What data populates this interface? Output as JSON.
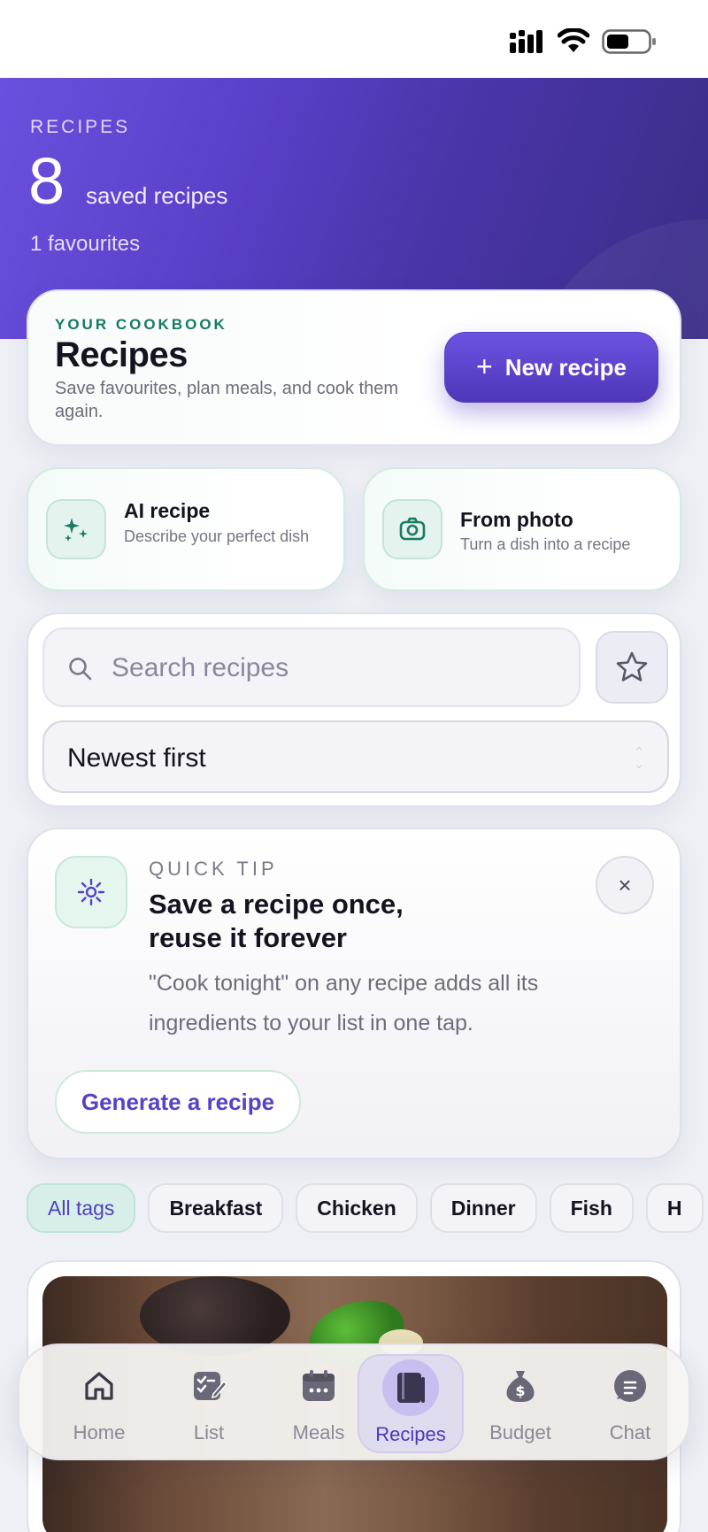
{
  "hero": {
    "label": "RECIPES",
    "count": "8",
    "count_label": "saved recipes",
    "favourites": "1 favourites"
  },
  "cookbook": {
    "eyebrow": "YOUR COOKBOOK",
    "title": "Recipes",
    "description": "Save favourites, plan meals, and cook them again.",
    "new_button": "New recipe"
  },
  "actions": {
    "ai": {
      "title": "AI recipe",
      "subtitle": "Describe your perfect dish",
      "icon": "sparkles-icon"
    },
    "photo": {
      "title": "From photo",
      "subtitle": "Turn a dish into a recipe",
      "icon": "camera-icon"
    }
  },
  "search": {
    "placeholder": "Search recipes",
    "value": "",
    "sort_value": "Newest first"
  },
  "tip": {
    "eyebrow": "QUICK TIP",
    "title": "Save a recipe once, reuse it forever",
    "body": "\"Cook tonight\" on any recipe adds all its ingredients to your list in one tap.",
    "button": "Generate a recipe",
    "close": "×"
  },
  "tags": [
    {
      "label": "All tags",
      "active": true
    },
    {
      "label": "Breakfast",
      "active": false
    },
    {
      "label": "Chicken",
      "active": false
    },
    {
      "label": "Dinner",
      "active": false
    },
    {
      "label": "Fish",
      "active": false
    },
    {
      "label": "H",
      "active": false
    }
  ],
  "nav": [
    {
      "label": "Home",
      "icon": "home-icon",
      "active": false
    },
    {
      "label": "List",
      "icon": "checklist-icon",
      "active": false
    },
    {
      "label": "Meals",
      "icon": "calendar-icon",
      "active": false
    },
    {
      "label": "Recipes",
      "icon": "book-icon",
      "active": true
    },
    {
      "label": "Budget",
      "icon": "money-bag-icon",
      "active": false
    },
    {
      "label": "Chat",
      "icon": "chat-icon",
      "active": false
    }
  ],
  "colors": {
    "accent": "#5a40c8",
    "hero_start": "#6b50df",
    "hero_end": "#3a2d86",
    "green": "#167a61"
  }
}
